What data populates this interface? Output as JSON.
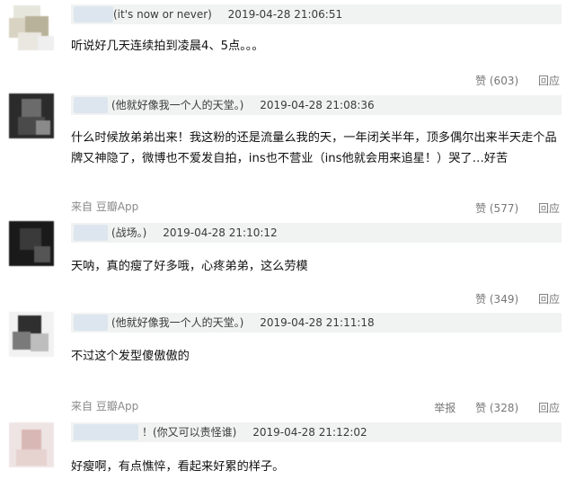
{
  "comments": [
    {
      "user_note": "(it's now or never)",
      "time": "2019-04-28 21:06:51",
      "text": "听说好几天连续拍到凌晨4、5点。。。",
      "source": "",
      "report_label": "",
      "like_label": "赞 (603)",
      "reply_label": "回应"
    },
    {
      "user_note": "(他就好像我一个人的天堂。)",
      "time": "2019-04-28 21:08:36",
      "text": "什么时候放弟弟出来！我这粉的还是流量么我的天，一年闭关半年，顶多偶尔出来半天走个品牌又神隐了，微博也不爱发自拍，ins也不营业（ins他就会用来追星！）哭了…好苦",
      "source": "来自 豆瓣App",
      "report_label": "",
      "like_label": "赞 (577)",
      "reply_label": "回应"
    },
    {
      "user_note": "(战场。)",
      "time": "2019-04-28 21:10:12",
      "text": "天呐，真的瘦了好多哦，心疼弟弟，这么劳模",
      "source": "",
      "report_label": "",
      "like_label": "赞 (349)",
      "reply_label": "回应"
    },
    {
      "user_note": "(他就好像我一个人的天堂。)",
      "time": "2019-04-28 21:11:18",
      "text": "不过这个发型傻傲傲的",
      "source": "来自 豆瓣App",
      "report_label": "举报",
      "like_label": "赞 (328)",
      "reply_label": "回应"
    },
    {
      "user_note": "！(你又可以责怪谁)",
      "time": "2019-04-28 21:12:02",
      "text": "好瘦啊，有点憔悴，看起来好累的样子。",
      "source": "",
      "report_label": "",
      "like_label": "",
      "reply_label": ""
    }
  ]
}
